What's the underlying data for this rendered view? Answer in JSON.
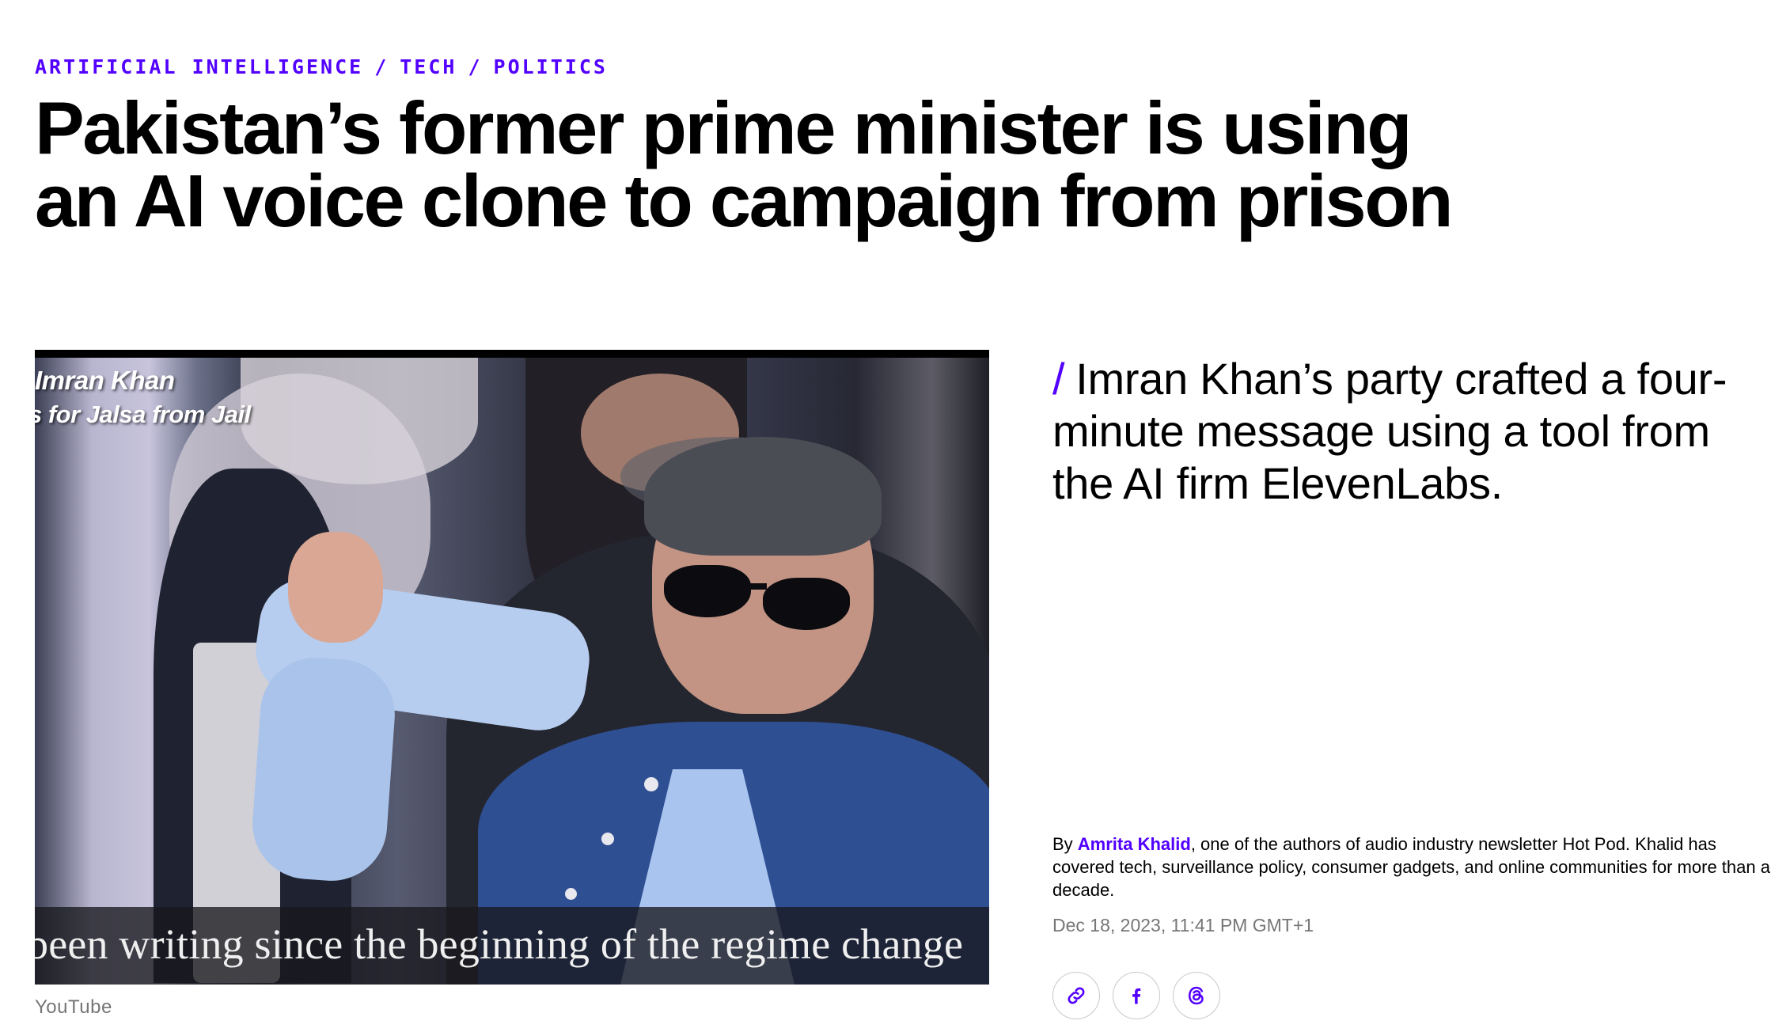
{
  "breadcrumb": {
    "items": [
      {
        "label": "ARTIFICIAL INTELLIGENCE"
      },
      {
        "label": "TECH"
      },
      {
        "label": "POLITICS"
      }
    ],
    "separator": "/"
  },
  "headline": "Pakistan’s former prime minister is using an AI voice clone to campaign from prison",
  "hero": {
    "overlay_title": "Imran Khan",
    "overlay_subtitle": "s for Jalsa from Jail",
    "caption": "been writing since the beginning of the regime change",
    "credit": "YouTube"
  },
  "dek": {
    "slash": "/",
    "text": "Imran Khan’s party crafted a four-minute message using a tool from the AI firm ElevenLabs."
  },
  "byline": {
    "prefix": "By ",
    "author": "Amrita Khalid",
    "bio": ", one of the authors of audio industry newsletter Hot Pod. Khalid has covered tech, surveillance policy, consumer gadgets, and online communities for more than a decade."
  },
  "timestamp": "Dec 18, 2023, 11:41 PM GMT+1",
  "share": {
    "icons": [
      "link-icon",
      "facebook-icon",
      "threads-icon"
    ],
    "accent": "#5200ff"
  },
  "colors": {
    "accent": "#5200ff",
    "muted": "#767676"
  }
}
